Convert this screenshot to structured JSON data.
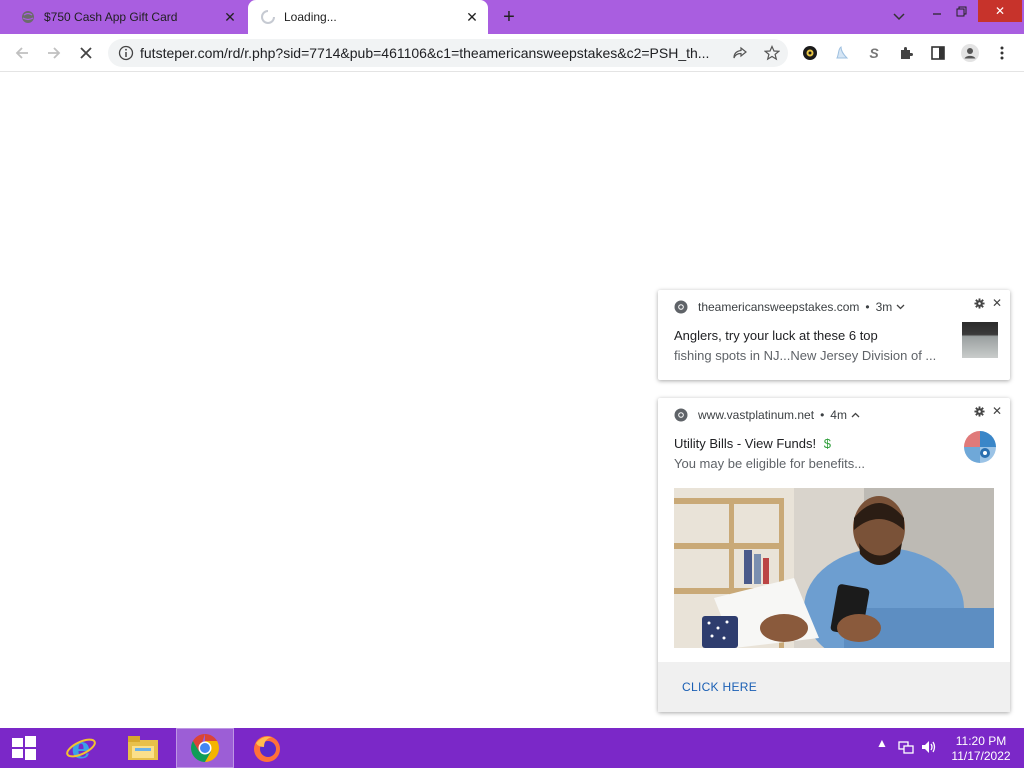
{
  "browser": {
    "tabs": [
      {
        "title": "$750 Cash App Gift Card",
        "state": "inactive"
      },
      {
        "title": "Loading...",
        "state": "active"
      }
    ],
    "address_bar": {
      "url": "futsteper.com/rd/r.php?sid=7714&pub=461106&c1=theamericansweepstakes&c2=PSH_th..."
    },
    "colors": {
      "titlebar": "#a95ee0",
      "taskbar": "#7b28c8"
    }
  },
  "notifications": [
    {
      "source": "theamericansweepstakes.com",
      "age": "3m",
      "title": "Anglers, try your luck at these 6 top",
      "body": "fishing spots in NJ...New Jersey Division of ..."
    },
    {
      "source": "www.vastplatinum.net",
      "age": "4m",
      "title": "Utility Bills - View Funds!",
      "title_suffix": "$",
      "body": "You may be eligible for benefits...",
      "action": "CLICK HERE"
    }
  ],
  "taskbar": {
    "apps": [
      "start",
      "internet-explorer",
      "file-explorer",
      "chrome",
      "firefox"
    ],
    "time": "11:20 PM",
    "date": "11/17/2022"
  }
}
